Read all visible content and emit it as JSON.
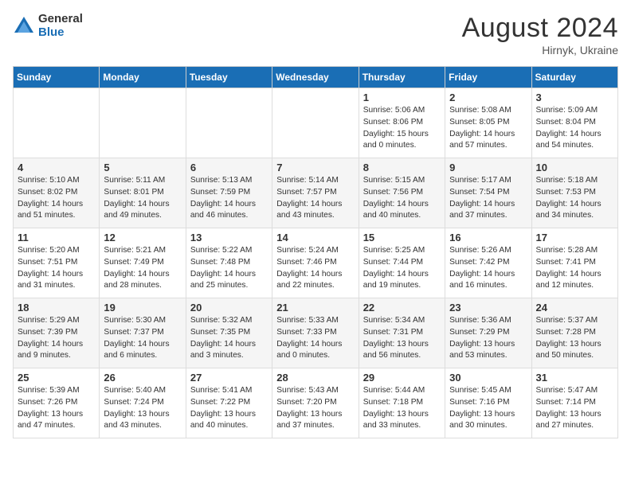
{
  "logo": {
    "general": "General",
    "blue": "Blue"
  },
  "title": {
    "month_year": "August 2024",
    "location": "Hirnyk, Ukraine"
  },
  "days_of_week": [
    "Sunday",
    "Monday",
    "Tuesday",
    "Wednesday",
    "Thursday",
    "Friday",
    "Saturday"
  ],
  "weeks": [
    [
      {
        "day": "",
        "content": ""
      },
      {
        "day": "",
        "content": ""
      },
      {
        "day": "",
        "content": ""
      },
      {
        "day": "",
        "content": ""
      },
      {
        "day": "1",
        "content": "Sunrise: 5:06 AM\nSunset: 8:06 PM\nDaylight: 15 hours\nand 0 minutes."
      },
      {
        "day": "2",
        "content": "Sunrise: 5:08 AM\nSunset: 8:05 PM\nDaylight: 14 hours\nand 57 minutes."
      },
      {
        "day": "3",
        "content": "Sunrise: 5:09 AM\nSunset: 8:04 PM\nDaylight: 14 hours\nand 54 minutes."
      }
    ],
    [
      {
        "day": "4",
        "content": "Sunrise: 5:10 AM\nSunset: 8:02 PM\nDaylight: 14 hours\nand 51 minutes."
      },
      {
        "day": "5",
        "content": "Sunrise: 5:11 AM\nSunset: 8:01 PM\nDaylight: 14 hours\nand 49 minutes."
      },
      {
        "day": "6",
        "content": "Sunrise: 5:13 AM\nSunset: 7:59 PM\nDaylight: 14 hours\nand 46 minutes."
      },
      {
        "day": "7",
        "content": "Sunrise: 5:14 AM\nSunset: 7:57 PM\nDaylight: 14 hours\nand 43 minutes."
      },
      {
        "day": "8",
        "content": "Sunrise: 5:15 AM\nSunset: 7:56 PM\nDaylight: 14 hours\nand 40 minutes."
      },
      {
        "day": "9",
        "content": "Sunrise: 5:17 AM\nSunset: 7:54 PM\nDaylight: 14 hours\nand 37 minutes."
      },
      {
        "day": "10",
        "content": "Sunrise: 5:18 AM\nSunset: 7:53 PM\nDaylight: 14 hours\nand 34 minutes."
      }
    ],
    [
      {
        "day": "11",
        "content": "Sunrise: 5:20 AM\nSunset: 7:51 PM\nDaylight: 14 hours\nand 31 minutes."
      },
      {
        "day": "12",
        "content": "Sunrise: 5:21 AM\nSunset: 7:49 PM\nDaylight: 14 hours\nand 28 minutes."
      },
      {
        "day": "13",
        "content": "Sunrise: 5:22 AM\nSunset: 7:48 PM\nDaylight: 14 hours\nand 25 minutes."
      },
      {
        "day": "14",
        "content": "Sunrise: 5:24 AM\nSunset: 7:46 PM\nDaylight: 14 hours\nand 22 minutes."
      },
      {
        "day": "15",
        "content": "Sunrise: 5:25 AM\nSunset: 7:44 PM\nDaylight: 14 hours\nand 19 minutes."
      },
      {
        "day": "16",
        "content": "Sunrise: 5:26 AM\nSunset: 7:42 PM\nDaylight: 14 hours\nand 16 minutes."
      },
      {
        "day": "17",
        "content": "Sunrise: 5:28 AM\nSunset: 7:41 PM\nDaylight: 14 hours\nand 12 minutes."
      }
    ],
    [
      {
        "day": "18",
        "content": "Sunrise: 5:29 AM\nSunset: 7:39 PM\nDaylight: 14 hours\nand 9 minutes."
      },
      {
        "day": "19",
        "content": "Sunrise: 5:30 AM\nSunset: 7:37 PM\nDaylight: 14 hours\nand 6 minutes."
      },
      {
        "day": "20",
        "content": "Sunrise: 5:32 AM\nSunset: 7:35 PM\nDaylight: 14 hours\nand 3 minutes."
      },
      {
        "day": "21",
        "content": "Sunrise: 5:33 AM\nSunset: 7:33 PM\nDaylight: 14 hours\nand 0 minutes."
      },
      {
        "day": "22",
        "content": "Sunrise: 5:34 AM\nSunset: 7:31 PM\nDaylight: 13 hours\nand 56 minutes."
      },
      {
        "day": "23",
        "content": "Sunrise: 5:36 AM\nSunset: 7:29 PM\nDaylight: 13 hours\nand 53 minutes."
      },
      {
        "day": "24",
        "content": "Sunrise: 5:37 AM\nSunset: 7:28 PM\nDaylight: 13 hours\nand 50 minutes."
      }
    ],
    [
      {
        "day": "25",
        "content": "Sunrise: 5:39 AM\nSunset: 7:26 PM\nDaylight: 13 hours\nand 47 minutes."
      },
      {
        "day": "26",
        "content": "Sunrise: 5:40 AM\nSunset: 7:24 PM\nDaylight: 13 hours\nand 43 minutes."
      },
      {
        "day": "27",
        "content": "Sunrise: 5:41 AM\nSunset: 7:22 PM\nDaylight: 13 hours\nand 40 minutes."
      },
      {
        "day": "28",
        "content": "Sunrise: 5:43 AM\nSunset: 7:20 PM\nDaylight: 13 hours\nand 37 minutes."
      },
      {
        "day": "29",
        "content": "Sunrise: 5:44 AM\nSunset: 7:18 PM\nDaylight: 13 hours\nand 33 minutes."
      },
      {
        "day": "30",
        "content": "Sunrise: 5:45 AM\nSunset: 7:16 PM\nDaylight: 13 hours\nand 30 minutes."
      },
      {
        "day": "31",
        "content": "Sunrise: 5:47 AM\nSunset: 7:14 PM\nDaylight: 13 hours\nand 27 minutes."
      }
    ]
  ]
}
